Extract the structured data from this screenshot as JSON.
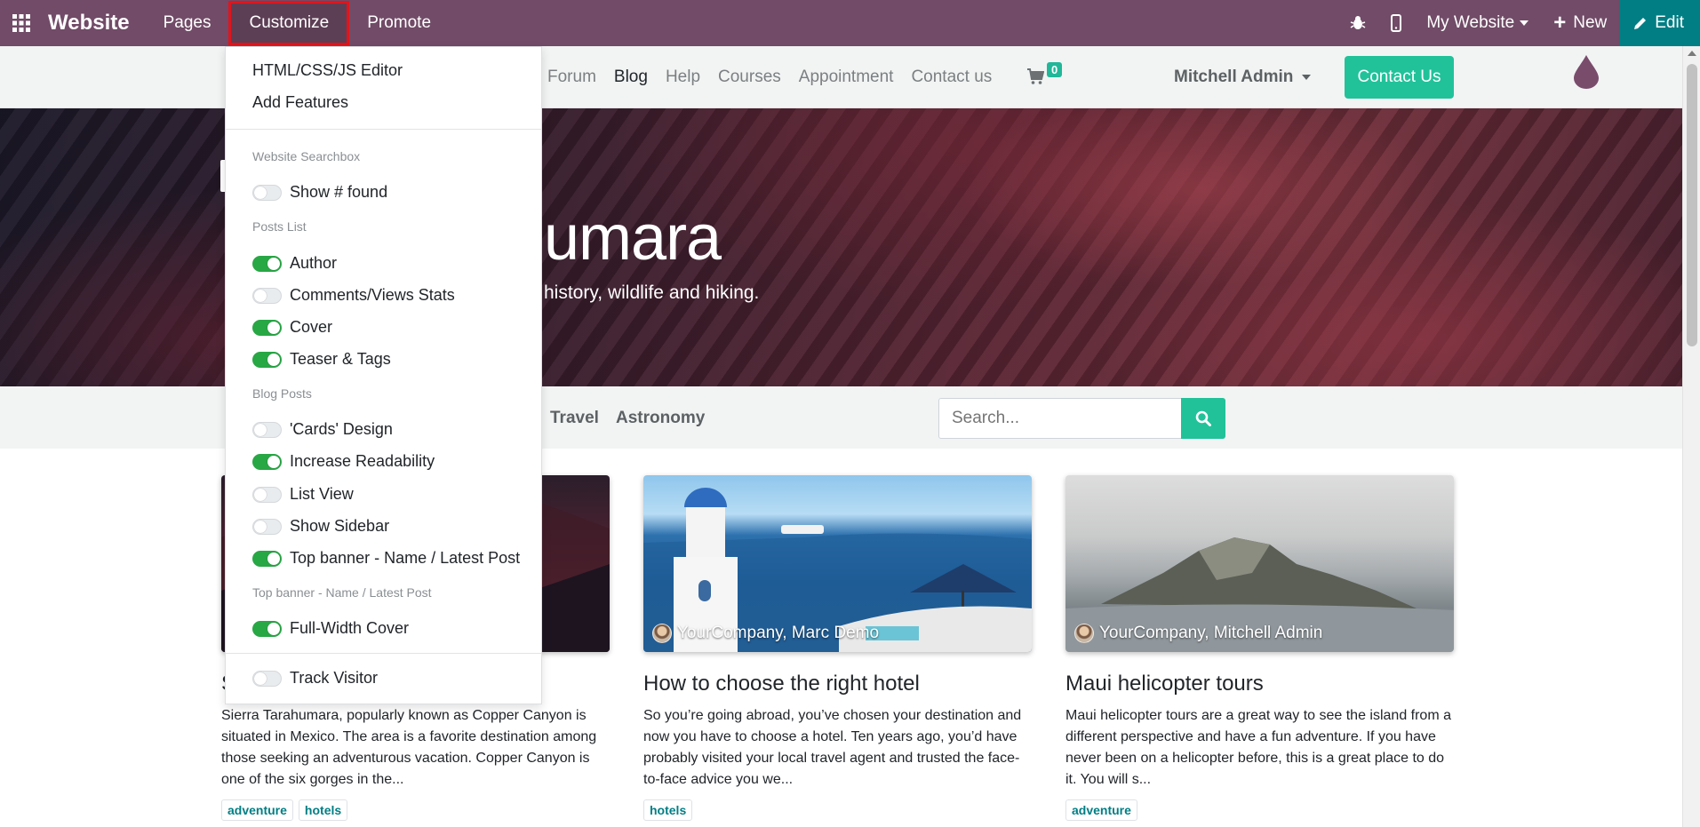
{
  "topbar": {
    "brand": "Website",
    "menus": [
      "Pages",
      "Customize",
      "Promote"
    ],
    "active_menu": "Customize",
    "my_website": "My Website",
    "new_label": "New",
    "edit_label": "Edit",
    "colors": {
      "bar": "#714b67",
      "edit": "#017e84",
      "highlight": "#e2141b"
    }
  },
  "site_header": {
    "nav": [
      "Forum",
      "Blog",
      "Help",
      "Courses",
      "Appointment",
      "Contact us"
    ],
    "current": "Blog",
    "cart_count": "0",
    "user": "Mitchell Admin",
    "contact_button": "Contact Us"
  },
  "hero": {
    "title_visible": "umara",
    "subtitle_visible": "history, wildlife and hiking."
  },
  "filter": {
    "tags": [
      "Travel",
      "Astronomy"
    ],
    "search_placeholder": "Search..."
  },
  "customize_menu": {
    "editor": "HTML/CSS/JS Editor",
    "add_features": "Add Features",
    "sections": [
      {
        "heading": "Website Searchbox",
        "options": [
          {
            "label": "Show # found",
            "on": false
          }
        ]
      },
      {
        "heading": "Posts List",
        "options": [
          {
            "label": "Author",
            "on": true
          },
          {
            "label": "Comments/Views Stats",
            "on": false
          },
          {
            "label": "Cover",
            "on": true
          },
          {
            "label": "Teaser & Tags",
            "on": true
          }
        ]
      },
      {
        "heading": "Blog Posts",
        "options": [
          {
            "label": "'Cards' Design",
            "on": false
          },
          {
            "label": "Increase Readability",
            "on": true
          },
          {
            "label": "List View",
            "on": false
          },
          {
            "label": "Show Sidebar",
            "on": false
          },
          {
            "label": "Top banner - Name / Latest Post",
            "on": true
          }
        ]
      },
      {
        "heading": "Top banner - Name / Latest Post",
        "options": [
          {
            "label": "Full-Width Cover",
            "on": true
          }
        ]
      }
    ],
    "track_visitor": {
      "label": "Track Visitor",
      "on": false
    }
  },
  "posts": [
    {
      "title": "S",
      "teaser": "Sierra Tarahumara, popularly known as Copper Canyon is situated in Mexico. The area is a favorite destination among those seeking an adventurous vacation. Copper Canyon is one of the six gorges in the...",
      "tags": [
        "adventure",
        "hotels"
      ]
    },
    {
      "authors": "YourCompany, Marc Demo",
      "title": "How to choose the right hotel",
      "teaser": "So you’re going abroad, you’ve chosen your destination and now you have to choose a hotel. Ten years ago, you’d have probably visited your local travel agent and trusted the face-to-face advice you we...",
      "tags": [
        "hotels"
      ]
    },
    {
      "authors": "YourCompany, Mitchell Admin",
      "title": "Maui helicopter tours",
      "teaser": "Maui helicopter tours are a great way to see the island from a different perspective and have a fun adventure. If you have never been on a helicopter before, this is a great place to do it. You will s...",
      "tags": [
        "adventure"
      ]
    }
  ]
}
